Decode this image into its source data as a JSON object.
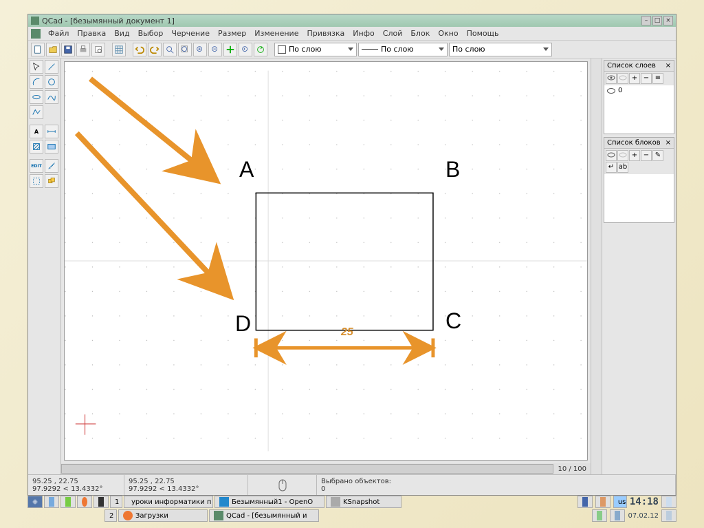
{
  "title": "QCad - [безымянный документ 1]",
  "menu": [
    "Файл",
    "Правка",
    "Вид",
    "Выбор",
    "Черчение",
    "Размер",
    "Изменение",
    "Привязка",
    "Инфо",
    "Слой",
    "Блок",
    "Окно",
    "Помощь"
  ],
  "layer_control": {
    "label": "По слою"
  },
  "linetype_control": {
    "label": "По слою"
  },
  "lineweight_control": {
    "label": "По слою"
  },
  "scroll_info": "10 / 100",
  "panels": {
    "layers": {
      "title": "Список слоев",
      "items": [
        "0"
      ]
    },
    "blocks": {
      "title": "Список блоков"
    }
  },
  "status": {
    "coord_abs": "95.25 , 22.75",
    "coord_rel": "97.9292 < 13.4332°",
    "coord_abs2": "95.25 , 22.75",
    "coord_rel2": "97.9292 < 13.4332°",
    "selected_label": "Выбрано объектов:",
    "selected_count": "0"
  },
  "taskbar": {
    "apps_row1": [
      "уроки информатики п",
      "Безымянный1 - OpenO",
      "KSnapshot"
    ],
    "apps_row2": [
      "2",
      "Загрузки",
      "QCad - [безымянный и"
    ],
    "clock": "14:18",
    "date": "07.02.12",
    "lang": "us"
  },
  "drawing": {
    "labels": {
      "A": "A",
      "B": "B",
      "C": "C",
      "D": "D"
    },
    "dimension": "25"
  }
}
